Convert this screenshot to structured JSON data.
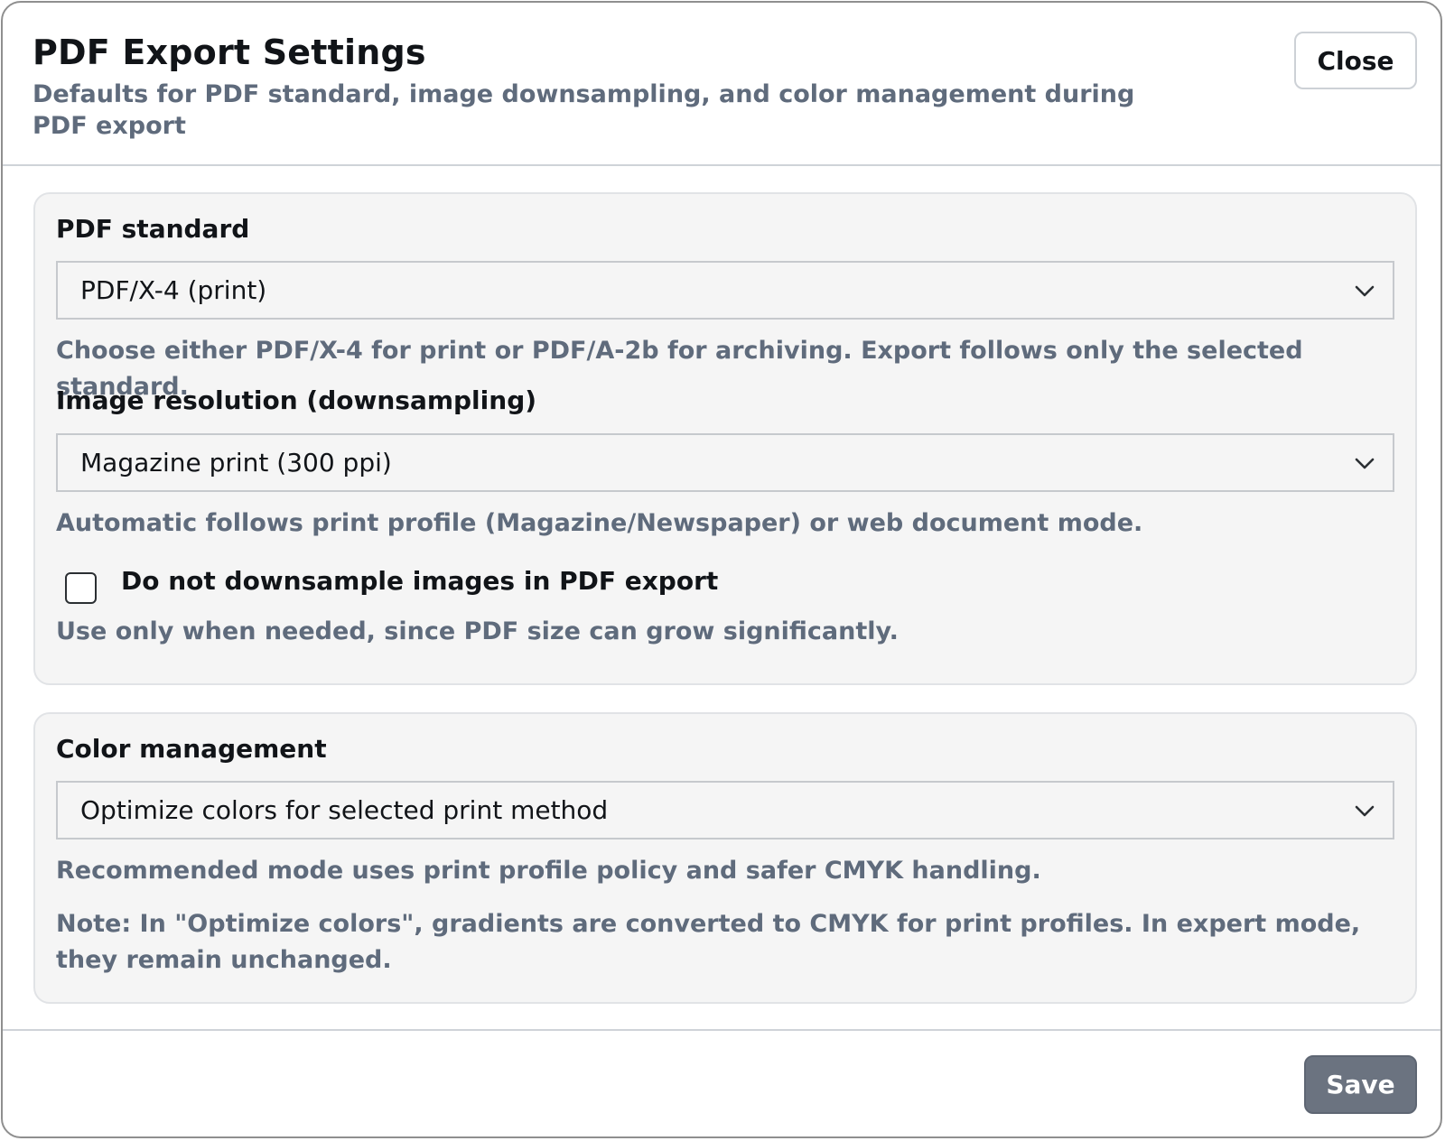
{
  "dialog": {
    "title": "PDF Export Settings",
    "subtitle": "Defaults for PDF standard, image downsampling, and color management during PDF export",
    "close_label": "Close",
    "save_label": "Save"
  },
  "pdf_standard": {
    "label": "PDF standard",
    "selected": "PDF/X-4 (print)",
    "hint": "Choose either PDF/X-4 for print or PDF/A-2b for archiving. Export follows only the selected standard."
  },
  "image_resolution": {
    "label": "Image resolution (downsampling)",
    "selected": "Magazine print (300 ppi)",
    "hint": "Automatic follows print profile (Magazine/Newspaper) or web document mode.",
    "no_downsample_label": "Do not downsample images in PDF export",
    "no_downsample_checked": false,
    "no_downsample_hint": "Use only when needed, since PDF size can grow significantly."
  },
  "color_management": {
    "label": "Color management",
    "selected": "Optimize colors for selected print method",
    "hint": "Recommended mode uses print profile policy and safer CMYK handling.",
    "note": "Note: In \"Optimize colors\", gradients are converted to CMYK for print profiles. In expert mode, they remain unchanged."
  },
  "colors": {
    "muted_text": "#5f6b7c",
    "save_button_bg": "#6b7380",
    "section_bg": "#f5f5f5"
  },
  "icons": {
    "select_arrow": "chevron-down-icon"
  }
}
